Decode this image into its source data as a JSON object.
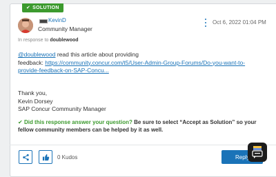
{
  "badge": {
    "label": "SOLUTION"
  },
  "author": {
    "name": "KevinD",
    "rank": "Community Manager"
  },
  "post": {
    "date": "Oct 6, 2022 01:04 PM",
    "in_response_prefix": "In response to",
    "in_response_user": "doublewood",
    "mention": "@doublewood",
    "text_before_link": " read this article about providing",
    "feedback_label": "feedback: ",
    "link_line1": "https://community.concur.com/t5/User-Admin-Group-Forums/Do-you-want-to-",
    "link_line2": "provide-feedback-on-SAP-Concu..."
  },
  "signature": {
    "line1": "Thank you,",
    "line2": "Kevin Dorsey",
    "line3": "SAP Concur Community Manager"
  },
  "accept_note": {
    "question": "Did this response answer your question?",
    "rest": " Be sure to select “Accept as Solution” so your fellow community members can be helped by it as well."
  },
  "footer": {
    "kudos": "0 Kudos",
    "reply_label": "Reply"
  },
  "icons": {
    "check": "check-icon",
    "more": "more-vertical-icon",
    "share": "share-icon",
    "kudo": "thumbs-up-icon",
    "chat": "chat-icon"
  },
  "colors": {
    "accent": "#1a73b8",
    "success": "#3c9a2e"
  }
}
